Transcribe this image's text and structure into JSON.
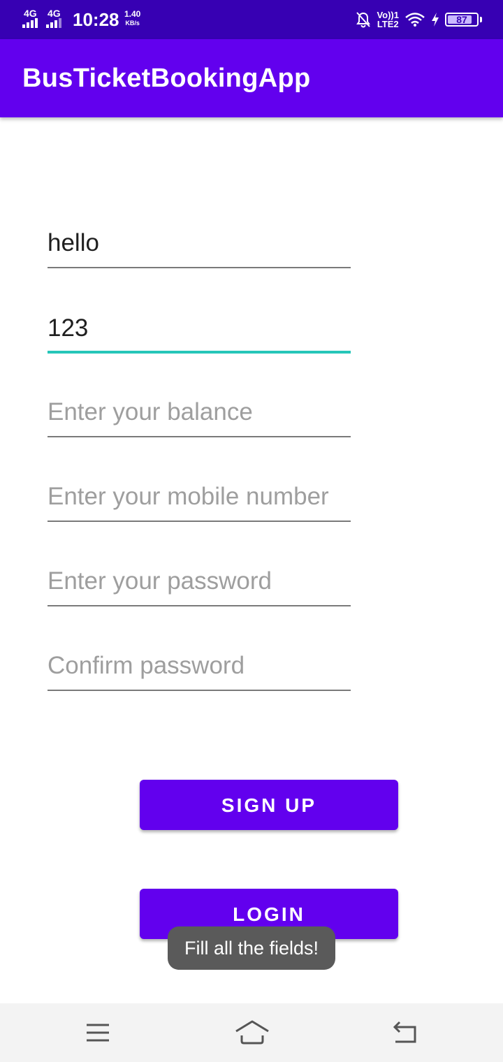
{
  "status_bar": {
    "network_1": "4G",
    "network_2": "4G",
    "time": "10:28",
    "speed_value": "1.40",
    "speed_unit": "KB/s",
    "volte": "Vo))",
    "sim": "1",
    "lte": "LTE2",
    "battery_level": "87",
    "battery_fraction": 0.87,
    "icons": [
      "signal-icon",
      "signal-icon",
      "mute-notification-icon",
      "wifi-icon",
      "charging-icon",
      "battery-icon"
    ]
  },
  "app_bar": {
    "title": "BusTicketBookingApp"
  },
  "form": {
    "name_field": {
      "value": "hello",
      "placeholder": ""
    },
    "id_field": {
      "value": "123",
      "placeholder": ""
    },
    "balance_field": {
      "value": "",
      "placeholder": "Enter your balance"
    },
    "mobile_field": {
      "value": "",
      "placeholder": "Enter your mobile number"
    },
    "password_field": {
      "value": "",
      "placeholder": "Enter your password"
    },
    "confirm_field": {
      "value": "",
      "placeholder": "Confirm password"
    }
  },
  "buttons": {
    "signup_label": "SIGN UP",
    "login_label": "LOGIN"
  },
  "toast": {
    "message": "Fill all the fields!"
  },
  "nav_bar": {
    "icons": [
      "menu-icon",
      "home-icon",
      "back-icon"
    ]
  },
  "colors": {
    "status_bar": "#3700b3",
    "primary": "#6200ee",
    "focus_accent": "#26c6b9",
    "toast_bg": "#5a5a5a",
    "nav_bg": "#f3f3f3"
  }
}
